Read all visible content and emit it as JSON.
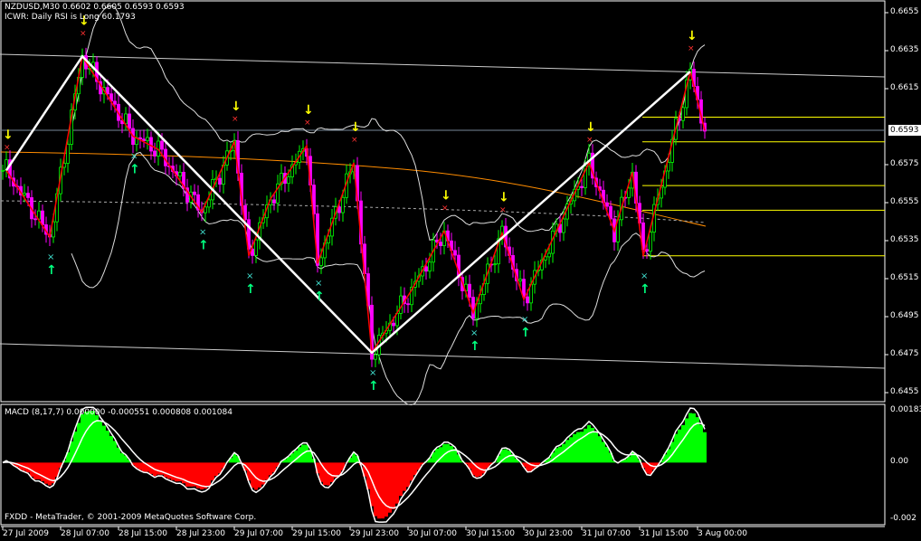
{
  "header": {
    "symbol_line": "NZDUSD,M30  0.6602 0.6605 0.6593 0.6593",
    "indicator_line": "ICWR: Daily RSI is Long 60.1793"
  },
  "macd_header": "MACD  (8,17,7) 0.000000 -0.000551 0.000808 0.001084",
  "footer_copyright": "FXDD - MetaTrader, © 2001-2009 MetaQuotes Software Corp.",
  "current_price": "0.6593",
  "colors": {
    "bull": "#00ff00",
    "bear": "#ff00ff",
    "zigzag": "#ff0000",
    "main_zigzag": "#ffffff",
    "levels": "#ffff00",
    "ma": "#ff8c00",
    "macd_pos": "#00ff00",
    "macd_neg": "#ff0000"
  },
  "chart_data": {
    "type": "candlestick",
    "symbol": "NZDUSD",
    "timeframe": "M30",
    "price_axis": {
      "ticks": [
        "0.6655",
        "0.6635",
        "0.6615",
        "0.6575",
        "0.6555",
        "0.6535",
        "0.6515",
        "0.6495",
        "0.6475",
        "0.6455"
      ],
      "range": [
        0.6448,
        0.666
      ]
    },
    "time_axis": {
      "ticks": [
        "27 Jul 2009",
        "28 Jul 07:00",
        "28 Jul 15:00",
        "28 Jul 23:00",
        "29 Jul 07:00",
        "29 Jul 15:00",
        "29 Jul 23:00",
        "30 Jul 07:00",
        "30 Jul 15:00",
        "30 Jul 23:00",
        "31 Jul 07:00",
        "31 Jul 15:00",
        "3 Aug 00:00"
      ],
      "bars_per_tick": 16
    },
    "zigzag": [
      [
        1,
        0.6572
      ],
      [
        13,
        0.6537
      ],
      [
        22,
        0.6632
      ],
      [
        36,
        0.659
      ],
      [
        43,
        0.6583
      ],
      [
        55,
        0.655
      ],
      [
        64,
        0.6587
      ],
      [
        68,
        0.6527
      ],
      [
        74,
        0.6557
      ],
      [
        84,
        0.6585
      ],
      [
        87,
        0.6523
      ],
      [
        97,
        0.6576
      ],
      [
        102,
        0.6476
      ],
      [
        113,
        0.6509
      ],
      [
        122,
        0.654
      ],
      [
        130,
        0.6497
      ],
      [
        138,
        0.6539
      ],
      [
        144,
        0.6504
      ],
      [
        162,
        0.6576
      ],
      [
        169,
        0.654
      ],
      [
        174,
        0.6571
      ],
      [
        177,
        0.6527
      ],
      [
        190,
        0.6624
      ],
      [
        194,
        0.6593
      ]
    ],
    "main_zigzag": [
      [
        1,
        0.6572
      ],
      [
        22,
        0.6632
      ],
      [
        102,
        0.6476
      ],
      [
        190,
        0.6624
      ]
    ],
    "sell_arrows": [
      1,
      22,
      64,
      84,
      97,
      122,
      138,
      162,
      190
    ],
    "buy_arrows": [
      13,
      36,
      55,
      68,
      87,
      102,
      130,
      144,
      177
    ],
    "levels": [
      0.66,
      0.6587,
      0.6564,
      0.6551,
      0.6527
    ],
    "macd": {
      "params": "8,17,7",
      "ticks": [
        "0.00183",
        "0.00",
        "-0.002"
      ],
      "range": [
        -0.0021,
        0.00195
      ]
    }
  }
}
